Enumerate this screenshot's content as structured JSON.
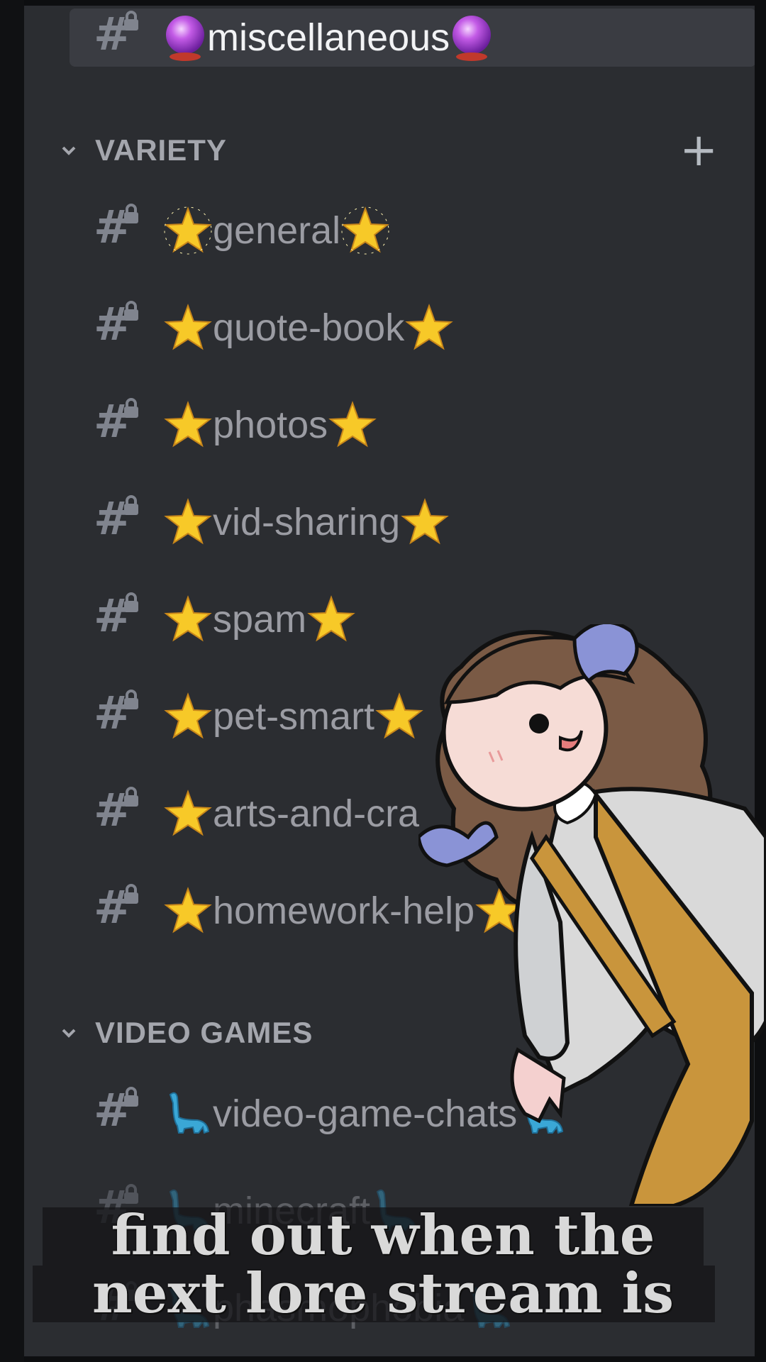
{
  "server_sidebar": {
    "selected_channel": {
      "label": "miscellaneous",
      "emoji": "purple-crystal-ball"
    },
    "categories": [
      {
        "name": "VARIETY",
        "add_icon": "plus-icon",
        "channels": [
          {
            "label": "general",
            "emoji": "glowing-star"
          },
          {
            "label": "quote-book",
            "emoji": "glowing-star"
          },
          {
            "label": "photos",
            "emoji": "glowing-star"
          },
          {
            "label": "vid-sharing",
            "emoji": "glowing-star"
          },
          {
            "label": "spam",
            "emoji": "glowing-star"
          },
          {
            "label": "pet-smart",
            "emoji": "glowing-star"
          },
          {
            "label": "arts-and-cra",
            "emoji": "glowing-star"
          },
          {
            "label": "homework-help",
            "emoji": "glowing-star"
          }
        ]
      },
      {
        "name": "VIDEO GAMES",
        "add_icon": "plus-icon",
        "channels": [
          {
            "label": "video-game-chats",
            "emoji": "sauropod"
          },
          {
            "label": "minecraft",
            "emoji": "sauropod"
          },
          {
            "label": "phasmophobia",
            "emoji": "sauropod"
          }
        ]
      }
    ]
  },
  "caption": {
    "line1": "find out when the",
    "line2": "next lore stream is"
  },
  "colors": {
    "sidebar_bg": "#2b2d31",
    "selected_bg": "#3a3c42",
    "channel_text": "#9b9ca3",
    "category_text": "#a4a6ad"
  }
}
